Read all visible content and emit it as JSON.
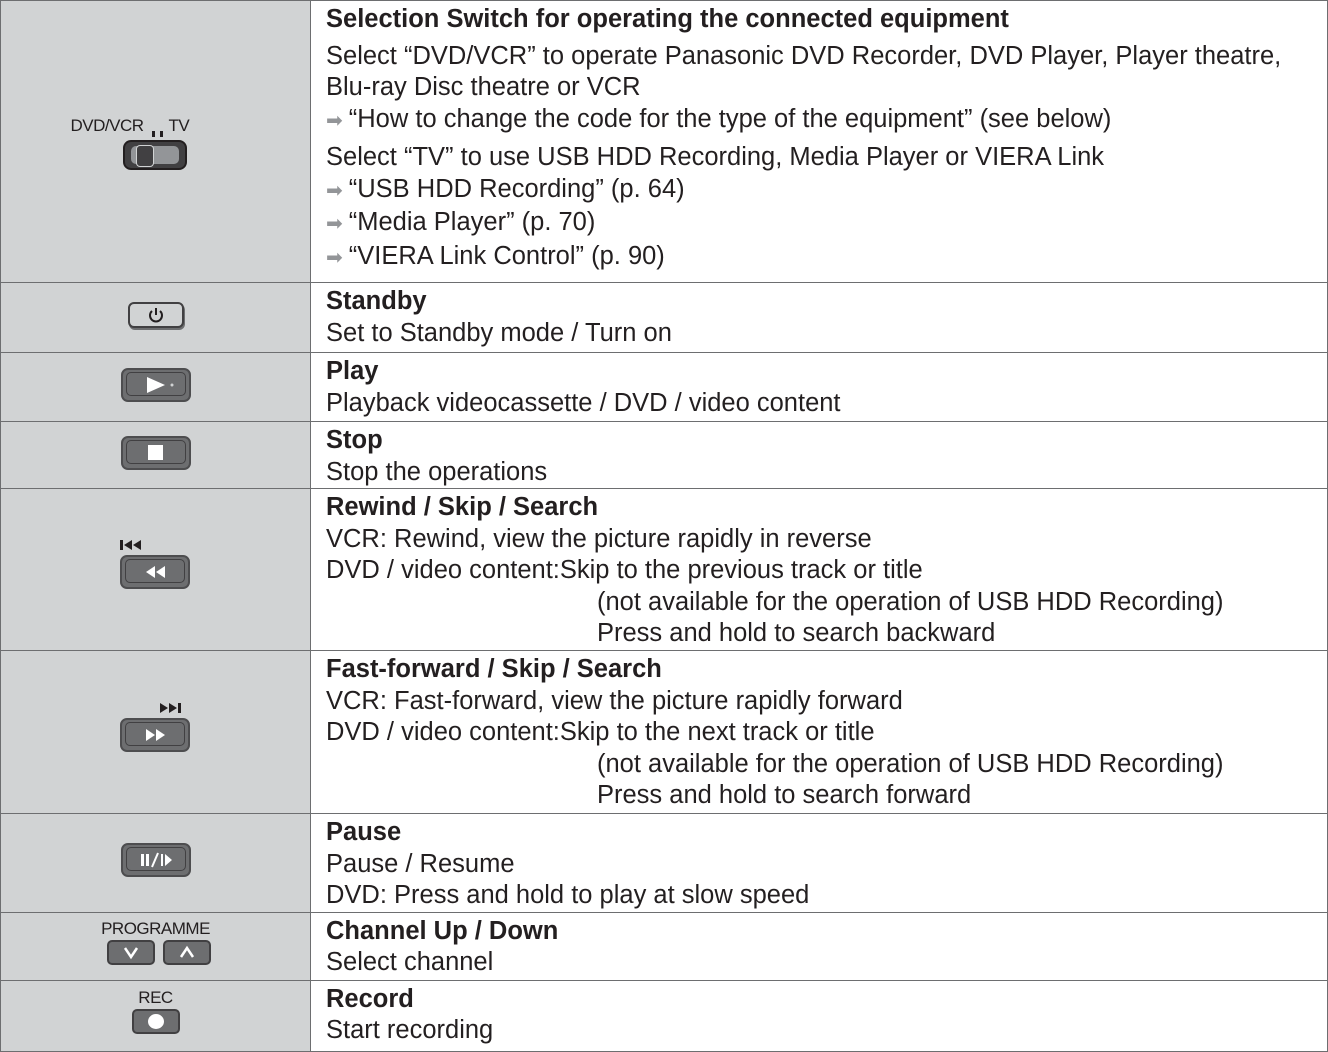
{
  "rows": [
    {
      "icon": "dvd-vcr-tv-switch-icon",
      "switch_left": "DVD/VCR",
      "switch_right": "TV",
      "title": "Selection Switch for operating the connected equipment",
      "line1": "Select “DVD/VCR” to operate Panasonic DVD Recorder, DVD Player, Player theatre, Blu-ray Disc theatre or VCR",
      "ref1": "“How to change the code for the type of the equipment” (see below)",
      "line2": "Select “TV” to use USB HDD Recording, Media Player or VIERA Link",
      "ref2": "“USB HDD Recording” (p. 64)",
      "ref3": "“Media Player” (p. 70)",
      "ref4": "“VIERA Link Control” (p. 90)"
    },
    {
      "icon": "standby-power-icon",
      "title": "Standby",
      "desc": "Set to Standby mode / Turn on"
    },
    {
      "icon": "play-icon",
      "title": "Play",
      "desc": "Playback videocassette / DVD / video content"
    },
    {
      "icon": "stop-icon",
      "title": "Stop",
      "desc": "Stop the operations"
    },
    {
      "icon": "rewind-skip-icon",
      "title": "Rewind / Skip / Search",
      "vcr_label": "VCR:",
      "vcr_text": "Rewind, view the picture rapidly in reverse",
      "dvd_label": "DVD / video content:",
      "dvd_text": "Skip to the previous track or title",
      "dvd_note": "(not available for the operation of USB HDD Recording)",
      "dvd_hold": "Press and hold to search backward"
    },
    {
      "icon": "fast-forward-skip-icon",
      "title": "Fast-forward / Skip / Search",
      "vcr_label": "VCR:",
      "vcr_text": "Fast-forward, view the picture rapidly forward",
      "dvd_label": "DVD / video content:",
      "dvd_text": "Skip to the next track or title",
      "dvd_note": "(not available for the operation of USB HDD Recording)",
      "dvd_hold": "Press and hold to search forward"
    },
    {
      "icon": "pause-slow-icon",
      "title": "Pause",
      "desc": "Pause / Resume",
      "dvd_line": "DVD: Press and hold to play at slow speed"
    },
    {
      "icon": "programme-up-down-icon",
      "button_label": "PROGRAMME",
      "title": "Channel Up / Down",
      "desc": "Select channel"
    },
    {
      "icon": "record-icon",
      "button_label": "REC",
      "title": "Record",
      "desc": "Start recording"
    }
  ]
}
